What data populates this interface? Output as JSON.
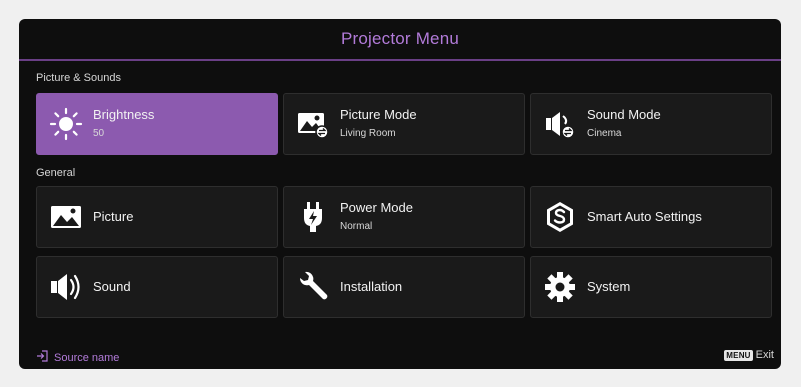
{
  "title": "Projector Menu",
  "sections": {
    "picture_sounds": "Picture & Sounds",
    "general": "General"
  },
  "tiles": {
    "brightness": {
      "label": "Brightness",
      "value": "50",
      "icon": "sun-icon"
    },
    "picture_mode": {
      "label": "Picture Mode",
      "value": "Living Room",
      "icon": "image-swap-icon"
    },
    "sound_mode": {
      "label": "Sound Mode",
      "value": "Cinema",
      "icon": "speaker-swap-icon"
    },
    "picture": {
      "label": "Picture",
      "icon": "image-icon"
    },
    "power_mode": {
      "label": "Power Mode",
      "value": "Normal",
      "icon": "plug-icon"
    },
    "smart_auto": {
      "label": "Smart Auto Settings",
      "icon": "s-badge-icon"
    },
    "sound": {
      "label": "Sound",
      "icon": "speaker-icon"
    },
    "installation": {
      "label": "Installation",
      "icon": "wrench-icon"
    },
    "system": {
      "label": "System",
      "icon": "gear-icon"
    }
  },
  "footer": {
    "source": "Source name",
    "menu_key": "MENU",
    "exit": "Exit"
  },
  "colors": {
    "accent": "#b27bd9",
    "selected_tile": "#8c5aaf",
    "window_bg": "#0e0e0e",
    "tile_bg": "#1a1a1a"
  }
}
